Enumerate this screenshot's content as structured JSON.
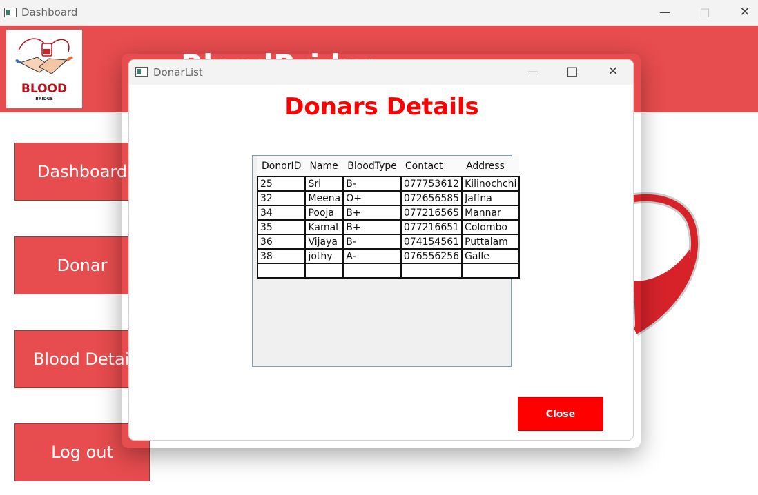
{
  "main_window": {
    "title": "Dashboard",
    "header_title": "BloodBridge",
    "logo_main": "BLOOD",
    "logo_sub": "BRIDGE",
    "nav": [
      {
        "label": "Dashboard"
      },
      {
        "label": "Donar"
      },
      {
        "label": "Blood Details"
      },
      {
        "label": "Log out"
      }
    ]
  },
  "dialog": {
    "title": "DonarList",
    "heading": "Donars Details",
    "close_label": "Close",
    "table": {
      "columns": [
        "DonorID",
        "Name",
        "BloodType",
        "Contact",
        "Address"
      ],
      "rows": [
        [
          "25",
          "Sri",
          "B-",
          "077753612",
          "Kilinochchi"
        ],
        [
          "32",
          "Meena",
          "O+",
          "072656585",
          "Jaffna"
        ],
        [
          "34",
          "Pooja",
          "B+",
          "077216565",
          "Mannar"
        ],
        [
          "35",
          "Kamal",
          "B+",
          "077216651",
          "Colombo"
        ],
        [
          "36",
          "Vijaya",
          "B-",
          "074154561",
          "Puttalam"
        ],
        [
          "38",
          "jothy",
          "A-",
          "076556256",
          "Galle"
        ],
        [
          "",
          "",
          "",
          "",
          ""
        ]
      ]
    }
  },
  "colors": {
    "header_red": "#e74c4e",
    "accent_red": "#ff0000",
    "grid_border": "#7a9cc6"
  },
  "icons": [
    "app-icon",
    "minimize-icon",
    "maximize-icon",
    "close-icon",
    "logo-image",
    "heart-image"
  ]
}
